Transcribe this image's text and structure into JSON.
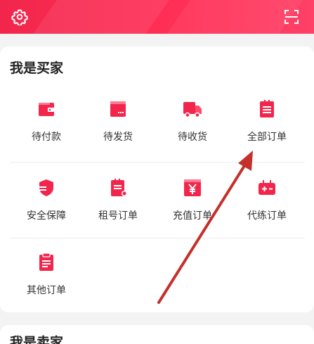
{
  "colors": {
    "accent": "#f2264c",
    "text": "#333333",
    "arrow": "#c4302b"
  },
  "header": {
    "settings_icon": "gear-icon",
    "scan_icon": "scan-icon"
  },
  "buyer": {
    "title": "我是买家",
    "items": [
      {
        "label": "待付款",
        "icon": "wallet-icon"
      },
      {
        "label": "待发货",
        "icon": "box-icon"
      },
      {
        "label": "待收货",
        "icon": "truck-icon"
      },
      {
        "label": "全部订单",
        "icon": "order-list-icon"
      },
      {
        "label": "安全保障",
        "icon": "shield-icon"
      },
      {
        "label": "租号订单",
        "icon": "rent-order-icon"
      },
      {
        "label": "充值订单",
        "icon": "yen-icon"
      },
      {
        "label": "代练订单",
        "icon": "gamepad-icon"
      },
      {
        "label": "其他订单",
        "icon": "clipboard-icon"
      }
    ]
  },
  "next_section": {
    "title": "我是卖家"
  }
}
